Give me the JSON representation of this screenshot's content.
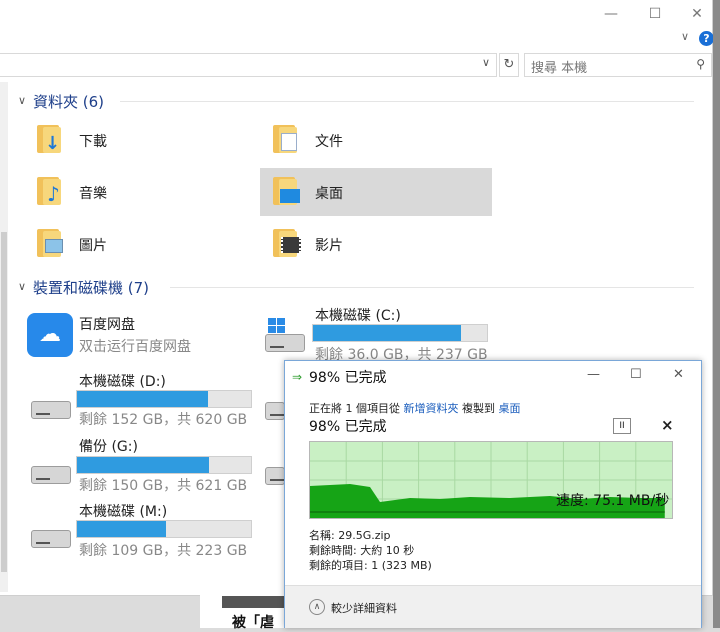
{
  "explorer": {
    "search_placeholder": "搜尋 本機",
    "help_label": "?",
    "groups": [
      {
        "title": "資料夾 (6)"
      },
      {
        "title": "裝置和磁碟機 (7)"
      }
    ],
    "folders": [
      {
        "label": "下載",
        "badge": "download-arrow"
      },
      {
        "label": "文件",
        "badge": "document"
      },
      {
        "label": "音樂",
        "badge": "music-note"
      },
      {
        "label": "桌面",
        "badge": "desktop",
        "selected": true
      },
      {
        "label": "圖片",
        "badge": "picture"
      },
      {
        "label": "影片",
        "badge": "film"
      }
    ],
    "baidu": {
      "name": "百度网盘",
      "subtitle": "双击运行百度网盘",
      "icon": "cloud-icon"
    },
    "drives": [
      {
        "name": "本機磁碟 (C:)",
        "free": "剩餘 36.0 GB，共 237 GB",
        "used_fraction": 0.85
      },
      {
        "name": "本機磁碟 (D:)",
        "free": "剩餘 152 GB，共 620 GB",
        "used_fraction": 0.75
      },
      {
        "name": "備份 (G:)",
        "free": "剩餘 150 GB，共 621 GB",
        "used_fraction": 0.76
      },
      {
        "name": "本機磁碟 (M:)",
        "free": "剩餘 109 GB，共 223 GB",
        "used_fraction": 0.51
      }
    ]
  },
  "background": {
    "partial_text": "被「虐"
  },
  "dialog": {
    "window_title": "98% 已完成",
    "status_line": {
      "prefix": "正在將 1 個項目從",
      "source": "新增資料夾",
      "middle": "複製到",
      "dest": "桌面"
    },
    "progress_title": "98% 已完成",
    "progress_fraction": 0.98,
    "speed": "速度: 75.1 MB/秒",
    "name": "名稱: 29.5G.zip",
    "time_left": "剩餘時間: 大約 10 秒",
    "items_left": "剩餘的項目: 1 (323 MB)",
    "less_details": "較少詳細資料",
    "pause_label": "II",
    "close_label": "×"
  },
  "colors": {
    "accent": "#2f9be0",
    "group_title": "#1e3f8a",
    "graph_bg": "#c9f0c4",
    "graph_fill": "#16a416",
    "link": "#1a5dbd"
  }
}
